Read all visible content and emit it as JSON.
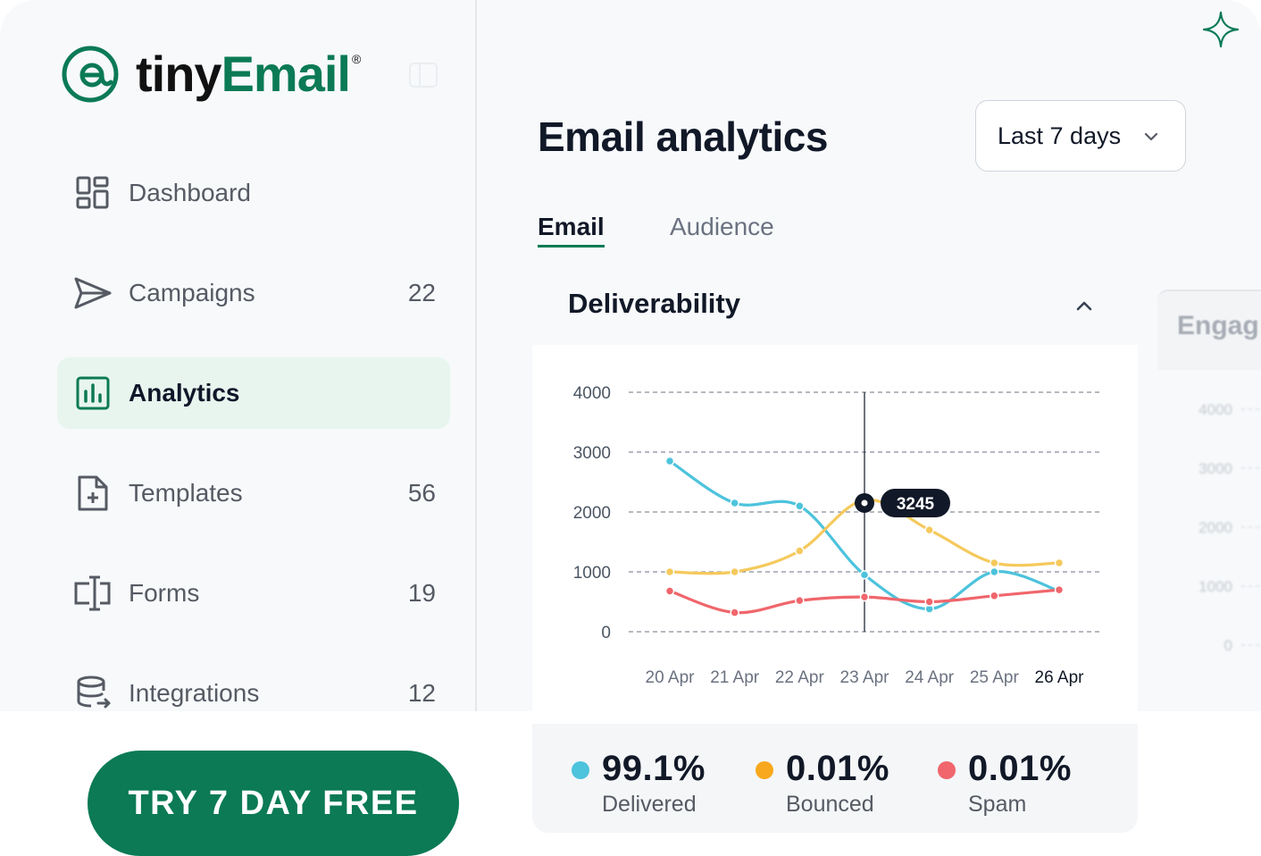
{
  "brand": {
    "name_prefix": "tiny",
    "name_suffix": "Email",
    "mark": "®",
    "green": "#0b7a55"
  },
  "sidebar": {
    "items": [
      {
        "label": "Dashboard",
        "count": "",
        "icon": "dashboard-grid-icon"
      },
      {
        "label": "Campaigns",
        "count": "22",
        "icon": "paper-plane-icon"
      },
      {
        "label": "Analytics",
        "count": "",
        "icon": "bar-chart-icon",
        "active": true
      },
      {
        "label": "Templates",
        "count": "56",
        "icon": "document-plus-icon"
      },
      {
        "label": "Forms",
        "count": "19",
        "icon": "form-field-icon"
      },
      {
        "label": "Integrations",
        "count": "12",
        "icon": "database-sync-icon"
      }
    ]
  },
  "cta": {
    "label": "TRY 7 DAY FREE"
  },
  "main": {
    "title": "Email analytics",
    "date_range": "Last 7 days",
    "tabs": [
      {
        "label": "Email",
        "active": true
      },
      {
        "label": "Audience",
        "active": false
      }
    ],
    "section_title": "Deliverability",
    "next_section_title": "Engag"
  },
  "chart_data": {
    "type": "line",
    "x": [
      "20 Apr",
      "21 Apr",
      "22 Apr",
      "23 Apr",
      "24 Apr",
      "25 Apr",
      "26 Apr"
    ],
    "highlighted_x": "26 Apr",
    "y_ticks": [
      4000,
      3000,
      2000,
      1000,
      0
    ],
    "ylim": [
      0,
      4000
    ],
    "grid": true,
    "series": [
      {
        "key": "delivered",
        "color": "#4dc3dc",
        "values": [
          2850,
          2150,
          2100,
          950,
          380,
          1000,
          680
        ]
      },
      {
        "key": "bounced",
        "color": "#f5c95c",
        "values": [
          1000,
          1000,
          1350,
          2200,
          1700,
          1150,
          1150
        ]
      },
      {
        "key": "spam",
        "color": "#f0666c",
        "values": [
          680,
          320,
          520,
          580,
          500,
          600,
          700
        ]
      }
    ],
    "tooltip": {
      "x": "23 Apr",
      "y": 2150,
      "label": "3245"
    }
  },
  "stats": [
    {
      "value": "99.1%",
      "label": "Delivered",
      "color": "#4dc3dc"
    },
    {
      "value": "0.01%",
      "label": "Bounced",
      "color": "#f8a81c"
    },
    {
      "value": "0.01%",
      "label": "Spam",
      "color": "#f0666c"
    }
  ],
  "ghost_ticks": [
    "4000",
    "3000",
    "2000",
    "1000",
    "0"
  ]
}
